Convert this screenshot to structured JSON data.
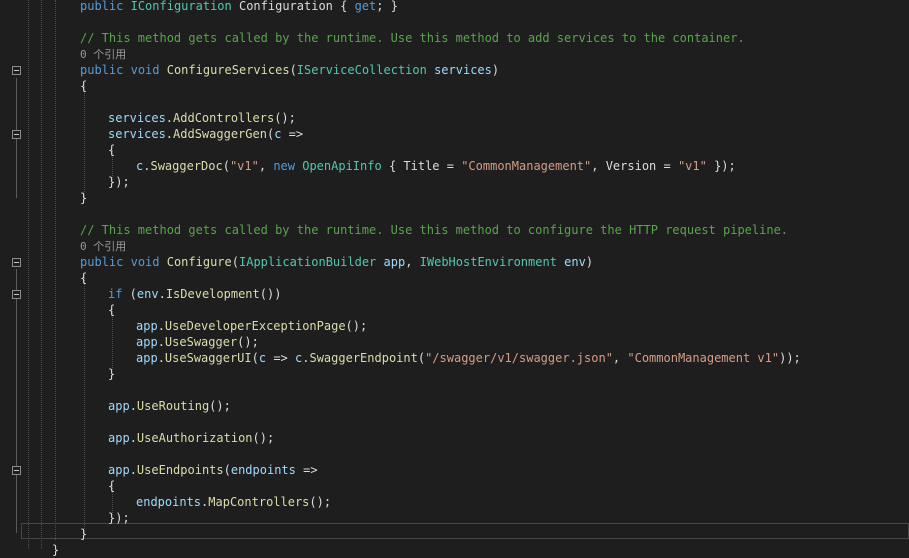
{
  "editor": {
    "lines": [
      {
        "tokens": [
          {
            "t": "public",
            "c": "kw"
          },
          {
            "t": " ",
            "c": "pl"
          },
          {
            "t": "IConfiguration",
            "c": "ty"
          },
          {
            "t": " Configuration { ",
            "c": "pl"
          },
          {
            "t": "get",
            "c": "kw"
          },
          {
            "t": "; }",
            "c": "pl"
          }
        ]
      },
      {
        "tokens": []
      },
      {
        "tokens": [
          {
            "t": "// This method gets called by the runtime. Use this method to add services to the container.",
            "c": "cm"
          }
        ]
      },
      {
        "tokens": [
          {
            "t": "0 个引用",
            "c": "ref"
          }
        ]
      },
      {
        "tokens": [
          {
            "t": "public",
            "c": "kw"
          },
          {
            "t": " ",
            "c": "pl"
          },
          {
            "t": "void",
            "c": "kw"
          },
          {
            "t": " ",
            "c": "pl"
          },
          {
            "t": "ConfigureServices",
            "c": "mt"
          },
          {
            "t": "(",
            "c": "pl"
          },
          {
            "t": "IServiceCollection",
            "c": "ty"
          },
          {
            "t": " ",
            "c": "pl"
          },
          {
            "t": "services",
            "c": "id"
          },
          {
            "t": ")",
            "c": "pl"
          }
        ]
      },
      {
        "tokens": [
          {
            "t": "{",
            "c": "pl"
          }
        ]
      },
      {
        "tokens": []
      },
      {
        "tokens": [
          {
            "t": "services",
            "c": "id"
          },
          {
            "t": ".",
            "c": "pl"
          },
          {
            "t": "AddControllers",
            "c": "mt"
          },
          {
            "t": "();",
            "c": "pl"
          }
        ]
      },
      {
        "tokens": [
          {
            "t": "services",
            "c": "id"
          },
          {
            "t": ".",
            "c": "pl"
          },
          {
            "t": "AddSwaggerGen",
            "c": "mt"
          },
          {
            "t": "(",
            "c": "pl"
          },
          {
            "t": "c",
            "c": "id"
          },
          {
            "t": " =>",
            "c": "pl"
          }
        ]
      },
      {
        "tokens": [
          {
            "t": "{",
            "c": "pl"
          }
        ]
      },
      {
        "tokens": [
          {
            "t": "c",
            "c": "id"
          },
          {
            "t": ".",
            "c": "pl"
          },
          {
            "t": "SwaggerDoc",
            "c": "mt"
          },
          {
            "t": "(",
            "c": "pl"
          },
          {
            "t": "\"v1\"",
            "c": "st"
          },
          {
            "t": ", ",
            "c": "pl"
          },
          {
            "t": "new",
            "c": "kw"
          },
          {
            "t": " ",
            "c": "pl"
          },
          {
            "t": "OpenApiInfo",
            "c": "ty"
          },
          {
            "t": " { Title = ",
            "c": "pl"
          },
          {
            "t": "\"CommonManagement\"",
            "c": "st"
          },
          {
            "t": ", Version = ",
            "c": "pl"
          },
          {
            "t": "\"v1\"",
            "c": "st"
          },
          {
            "t": " });",
            "c": "pl"
          }
        ]
      },
      {
        "tokens": [
          {
            "t": "});",
            "c": "pl"
          }
        ]
      },
      {
        "tokens": [
          {
            "t": "}",
            "c": "pl"
          }
        ]
      },
      {
        "tokens": []
      },
      {
        "tokens": [
          {
            "t": "// This method gets called by the runtime. Use this method to configure the HTTP request pipeline.",
            "c": "cm"
          }
        ]
      },
      {
        "tokens": [
          {
            "t": "0 个引用",
            "c": "ref"
          }
        ]
      },
      {
        "tokens": [
          {
            "t": "public",
            "c": "kw"
          },
          {
            "t": " ",
            "c": "pl"
          },
          {
            "t": "void",
            "c": "kw"
          },
          {
            "t": " ",
            "c": "pl"
          },
          {
            "t": "Configure",
            "c": "mt"
          },
          {
            "t": "(",
            "c": "pl"
          },
          {
            "t": "IApplicationBuilder",
            "c": "ty"
          },
          {
            "t": " ",
            "c": "pl"
          },
          {
            "t": "app",
            "c": "id"
          },
          {
            "t": ", ",
            "c": "pl"
          },
          {
            "t": "IWebHostEnvironment",
            "c": "ty"
          },
          {
            "t": " ",
            "c": "pl"
          },
          {
            "t": "env",
            "c": "id"
          },
          {
            "t": ")",
            "c": "pl"
          }
        ]
      },
      {
        "tokens": [
          {
            "t": "{",
            "c": "pl"
          }
        ]
      },
      {
        "tokens": [
          {
            "t": "if",
            "c": "kw"
          },
          {
            "t": " (",
            "c": "pl"
          },
          {
            "t": "env",
            "c": "id"
          },
          {
            "t": ".",
            "c": "pl"
          },
          {
            "t": "IsDevelopment",
            "c": "mt"
          },
          {
            "t": "())",
            "c": "pl"
          }
        ]
      },
      {
        "tokens": [
          {
            "t": "{",
            "c": "pl"
          }
        ]
      },
      {
        "tokens": [
          {
            "t": "app",
            "c": "id"
          },
          {
            "t": ".",
            "c": "pl"
          },
          {
            "t": "UseDeveloperExceptionPage",
            "c": "mt"
          },
          {
            "t": "();",
            "c": "pl"
          }
        ]
      },
      {
        "tokens": [
          {
            "t": "app",
            "c": "id"
          },
          {
            "t": ".",
            "c": "pl"
          },
          {
            "t": "UseSwagger",
            "c": "mt"
          },
          {
            "t": "();",
            "c": "pl"
          }
        ]
      },
      {
        "tokens": [
          {
            "t": "app",
            "c": "id"
          },
          {
            "t": ".",
            "c": "pl"
          },
          {
            "t": "UseSwaggerUI",
            "c": "mt"
          },
          {
            "t": "(",
            "c": "pl"
          },
          {
            "t": "c",
            "c": "id"
          },
          {
            "t": " => ",
            "c": "pl"
          },
          {
            "t": "c",
            "c": "id"
          },
          {
            "t": ".",
            "c": "pl"
          },
          {
            "t": "SwaggerEndpoint",
            "c": "mt"
          },
          {
            "t": "(",
            "c": "pl"
          },
          {
            "t": "\"/swagger/v1/swagger.json\"",
            "c": "st"
          },
          {
            "t": ", ",
            "c": "pl"
          },
          {
            "t": "\"CommonManagement v1\"",
            "c": "st"
          },
          {
            "t": "));",
            "c": "pl"
          }
        ]
      },
      {
        "tokens": [
          {
            "t": "}",
            "c": "pl"
          }
        ]
      },
      {
        "tokens": []
      },
      {
        "tokens": [
          {
            "t": "app",
            "c": "id"
          },
          {
            "t": ".",
            "c": "pl"
          },
          {
            "t": "UseRouting",
            "c": "mt"
          },
          {
            "t": "();",
            "c": "pl"
          }
        ]
      },
      {
        "tokens": []
      },
      {
        "tokens": [
          {
            "t": "app",
            "c": "id"
          },
          {
            "t": ".",
            "c": "pl"
          },
          {
            "t": "UseAuthorization",
            "c": "mt"
          },
          {
            "t": "();",
            "c": "pl"
          }
        ]
      },
      {
        "tokens": []
      },
      {
        "tokens": [
          {
            "t": "app",
            "c": "id"
          },
          {
            "t": ".",
            "c": "pl"
          },
          {
            "t": "UseEndpoints",
            "c": "mt"
          },
          {
            "t": "(",
            "c": "pl"
          },
          {
            "t": "endpoints",
            "c": "id"
          },
          {
            "t": " =>",
            "c": "pl"
          }
        ]
      },
      {
        "tokens": [
          {
            "t": "{",
            "c": "pl"
          }
        ]
      },
      {
        "tokens": [
          {
            "t": "endpoints",
            "c": "id"
          },
          {
            "t": ".",
            "c": "pl"
          },
          {
            "t": "MapControllers",
            "c": "mt"
          },
          {
            "t": "();",
            "c": "pl"
          }
        ]
      },
      {
        "tokens": [
          {
            "t": "});",
            "c": "pl"
          }
        ]
      },
      {
        "tokens": [
          {
            "t": "}",
            "c": "pl"
          }
        ]
      },
      {
        "tokens": [
          {
            "t": "}",
            "c": "pl"
          }
        ]
      }
    ]
  },
  "colors": {
    "background": "#1e1e1e",
    "keyword": "#569cd6",
    "type": "#4ec9b0",
    "identifier": "#9cdcfe",
    "method": "#dcdcaa",
    "comment": "#57a64a",
    "string": "#d69d85",
    "plain": "#dcdcdc",
    "codelens": "#999999"
  }
}
